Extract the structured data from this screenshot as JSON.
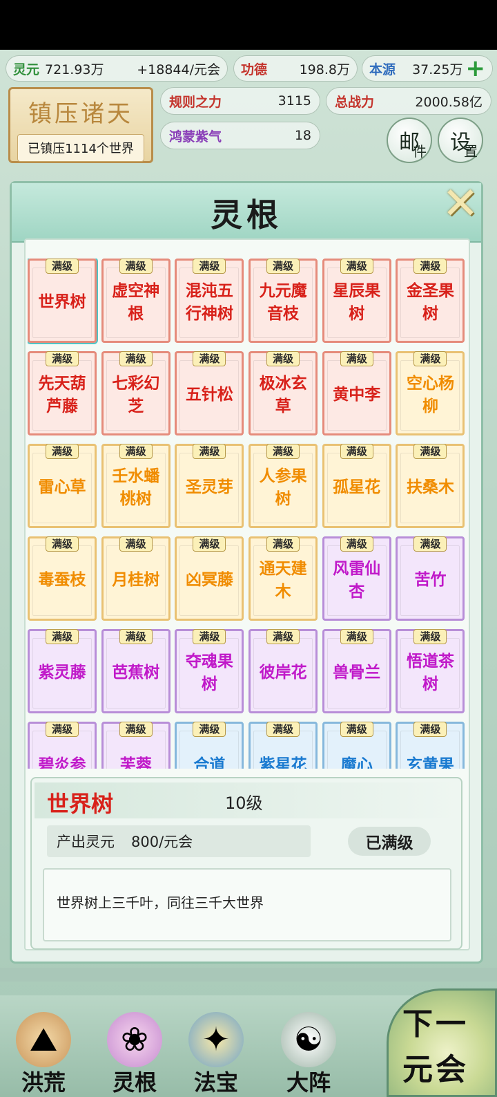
{
  "resources": {
    "lingyuan_label": "灵元",
    "lingyuan_value": "721.93万",
    "rate": "+18844/元会",
    "gongde_label": "功德",
    "gongde_value": "198.8万",
    "benyuan_label": "本源",
    "benyuan_value": "37.25万",
    "add_symbol": "+"
  },
  "title_box": {
    "title": "镇压诸天",
    "subtitle": "已镇压1114个世界"
  },
  "stats": {
    "guize_label": "规则之力",
    "guize_value": "3115",
    "zongzhanli_label": "总战力",
    "zongzhanli_value": "2000.58亿",
    "hongmeng_label": "鸿蒙紫气",
    "hongmeng_value": "18"
  },
  "buttons": {
    "mail_main": "邮",
    "mail_sub": "件",
    "settings_main": "设",
    "settings_sub": "置"
  },
  "modal": {
    "title": "灵根",
    "close": "✕"
  },
  "badge_text": "满级",
  "cards": [
    {
      "name": "世界树",
      "quality": "red",
      "selected": true
    },
    {
      "name": "虚空神根",
      "quality": "red"
    },
    {
      "name": "混沌五行神树",
      "quality": "red"
    },
    {
      "name": "九元魔音枝",
      "quality": "red"
    },
    {
      "name": "星辰果树",
      "quality": "red"
    },
    {
      "name": "金圣果树",
      "quality": "red"
    },
    {
      "name": "先天葫芦藤",
      "quality": "red"
    },
    {
      "name": "七彩幻芝",
      "quality": "red"
    },
    {
      "name": "五针松",
      "quality": "red"
    },
    {
      "name": "极冰玄草",
      "quality": "red"
    },
    {
      "name": "黄中李",
      "quality": "red"
    },
    {
      "name": "空心杨柳",
      "quality": "orange"
    },
    {
      "name": "雷心草",
      "quality": "orange"
    },
    {
      "name": "壬水蟠桃树",
      "quality": "orange"
    },
    {
      "name": "圣灵芽",
      "quality": "orange"
    },
    {
      "name": "人参果树",
      "quality": "orange"
    },
    {
      "name": "孤星花",
      "quality": "orange"
    },
    {
      "name": "扶桑木",
      "quality": "orange"
    },
    {
      "name": "毒蚕枝",
      "quality": "orange"
    },
    {
      "name": "月桂树",
      "quality": "orange"
    },
    {
      "name": "凶冥藤",
      "quality": "orange"
    },
    {
      "name": "通天建木",
      "quality": "orange"
    },
    {
      "name": "风雷仙杏",
      "quality": "purple"
    },
    {
      "name": "苦竹",
      "quality": "purple"
    },
    {
      "name": "紫灵藤",
      "quality": "purple"
    },
    {
      "name": "芭蕉树",
      "quality": "purple"
    },
    {
      "name": "夺魂果树",
      "quality": "purple"
    },
    {
      "name": "彼岸花",
      "quality": "purple"
    },
    {
      "name": "兽骨兰",
      "quality": "purple"
    },
    {
      "name": "悟道茶树",
      "quality": "purple"
    },
    {
      "name": "碧炎参",
      "quality": "purple"
    },
    {
      "name": "芙蓉",
      "quality": "purple"
    },
    {
      "name": "合道",
      "quality": "blue"
    },
    {
      "name": "紫星花",
      "quality": "blue"
    },
    {
      "name": "魔心",
      "quality": "blue"
    },
    {
      "name": "玄黄果",
      "quality": "blue"
    }
  ],
  "detail": {
    "name": "世界树",
    "level": "10级",
    "output_label": "产出灵元",
    "output_value": "800/元会",
    "maxed_label": "已满级",
    "description": "世界树上三千叶，同往三千大世界"
  },
  "nav": {
    "items": [
      {
        "label": "洪荒",
        "icon": "mountain-icon"
      },
      {
        "label": "灵根",
        "icon": "lotus-icon"
      },
      {
        "label": "法宝",
        "icon": "treasure-icon"
      },
      {
        "label": "大阵",
        "icon": "taiji-icon"
      }
    ],
    "next_line1": "下一",
    "next_line2": "元会"
  },
  "colors": {
    "red": "#d8211a",
    "orange": "#f08c00",
    "purple": "#c019c9",
    "blue": "#1a7ad0"
  }
}
